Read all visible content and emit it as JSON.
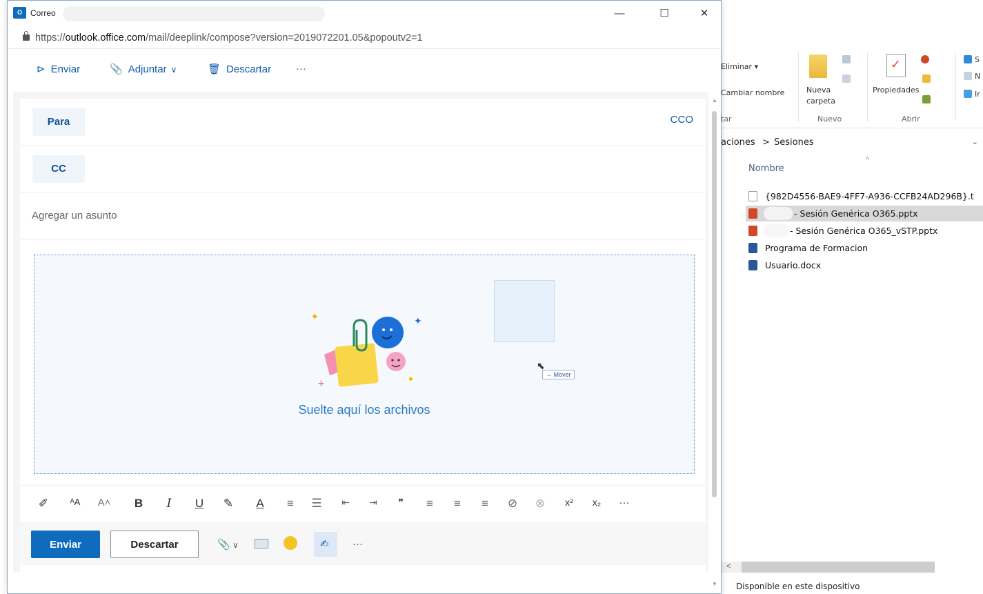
{
  "window": {
    "title": "Correo",
    "minimize": "—",
    "maximize": "☐",
    "close": "✕",
    "url_prefix": "https://",
    "url_host": "outlook.office.com",
    "url_path": "/mail/deeplink/compose?version=2019072201.05&popoutv2=1"
  },
  "commands": {
    "send": "Enviar",
    "attach": "Adjuntar",
    "discard": "Descartar",
    "more": "···"
  },
  "compose": {
    "to_label": "Para",
    "bcc_label": "CCO",
    "cc_label": "CC",
    "subject_placeholder": "Agregar un asunto",
    "drop_text": "Suelte aquí los archivos",
    "move_tooltip": "→ Mover"
  },
  "format_toolbar": [
    "✐",
    "ᴬA",
    "A˄",
    "B",
    "I",
    "U",
    "✎",
    "A",
    "≡",
    "☰",
    "⇤",
    "⇥",
    "❞",
    "≡",
    "≡",
    "≡",
    "⊘",
    "⊗",
    "x²",
    "x₂",
    "···"
  ],
  "footer": {
    "send": "Enviar",
    "discard": "Descartar",
    "more": "···"
  },
  "explorer": {
    "ribbon": {
      "delete": "Eliminar ▾",
      "rename": "Cambiar nombre",
      "new_folder": "Nueva carpeta",
      "properties": "Propiedades",
      "group_partial": "tar",
      "group_new": "Nuevo",
      "group_open": "Abrir",
      "partial_s": "S",
      "partial_n": "N",
      "partial_i": "Ir"
    },
    "breadcrumb_1": "aciones",
    "breadcrumb_sep": ">",
    "breadcrumb_2": "Sesiones",
    "column_name": "Nombre",
    "files": [
      {
        "name": "{982D4556-BAE9-4FF7-A936-CCFB24AD296B}.t",
        "type": "blank"
      },
      {
        "name": " - Sesión Genérica O365.pptx",
        "type": "ppt"
      },
      {
        "name": " - Sesión Genérica O365_vSTP.pptx",
        "type": "ppt"
      },
      {
        "name": "Programa de Formacion",
        "type": "word"
      },
      {
        "name": "Usuario.docx",
        "type": "word"
      }
    ],
    "status": "Disponible en este dispositivo"
  },
  "colors": {
    "accent": "#0f6cbd",
    "link": "#0f5cab",
    "dropzone_border": "#5b8fd3"
  }
}
